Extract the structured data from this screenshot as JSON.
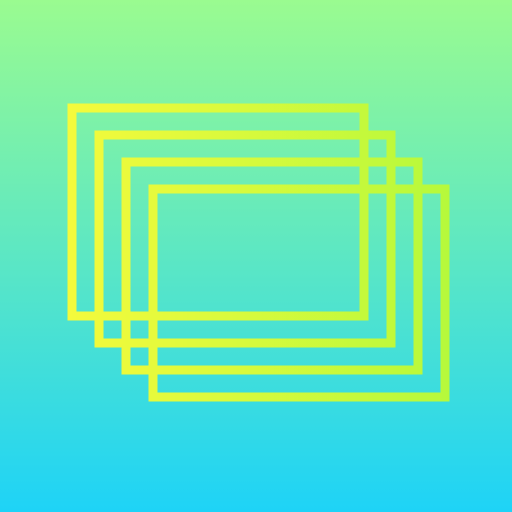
{
  "icon": {
    "name": "stacked-frames-icon",
    "background_gradient": {
      "top": "#9AFB90",
      "bottom": "#1ED3F7"
    },
    "stroke_gradient": {
      "start": "#F4FA3C",
      "end": "#B6F93B"
    },
    "frame_count": 4
  }
}
